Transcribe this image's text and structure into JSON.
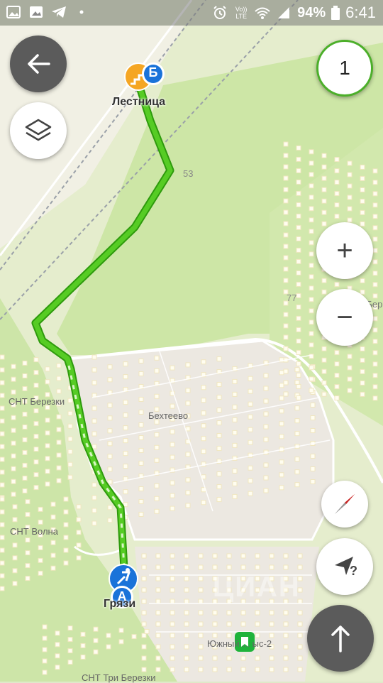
{
  "status_bar": {
    "battery": "94%",
    "time": "6:41",
    "network": "Vo)) LTE",
    "icons": [
      "photo-icon",
      "gallery-icon",
      "telegram-icon",
      "dot-icon",
      "alarm-icon",
      "volte-icon",
      "wifi-icon",
      "signal-icon",
      "battery-icon"
    ]
  },
  "controls": {
    "back": "arrow-left-icon",
    "layers": "layers-icon",
    "counter": "1",
    "zoom_in": "+",
    "zoom_out": "−",
    "compass": "compass-icon",
    "locate": "locate-icon",
    "locate_badge": "?",
    "start": "arrow-up-icon"
  },
  "map": {
    "labels": {
      "destination": "Лестница",
      "start": "Грязи",
      "village": "Бехтеево",
      "snt_berezki": "СНТ Березки",
      "snt_volna": "СНТ Волна",
      "snt_tri_berezki": "СНТ Три Березки",
      "snt_right": "СНТ Бере",
      "south": "Южный ... ыс-2",
      "num_53": "53",
      "num_77": "77",
      "watermark": "ЦИАН"
    },
    "markers": {
      "a": "A",
      "b": "Б"
    },
    "colors": {
      "route": "#48c21b",
      "route_dark": "#2e9a0d",
      "marker_blue": "#1a73d9",
      "marker_orange": "#f5a623",
      "forest": "#c9e2a4",
      "field": "#e9edd6",
      "settlement": "#ece9e2",
      "counter_ring": "#4caf2a"
    }
  }
}
